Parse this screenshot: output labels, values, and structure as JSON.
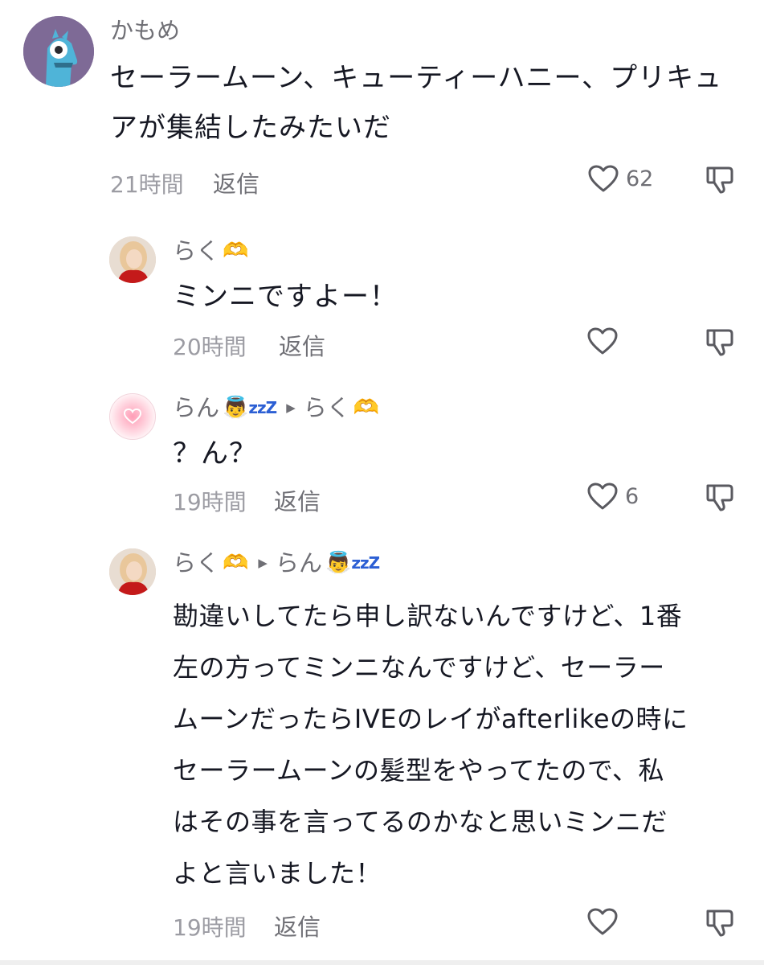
{
  "comments": [
    {
      "username": "かもめ",
      "text_lines": [
        "セーラームーン、キューティーハニー、プリキュ",
        "アが集結したみたいだ"
      ],
      "time": "21時間",
      "reply_label": "返信",
      "like_count": "62",
      "avatar_icon": "monster-avatar"
    },
    {
      "username": "らく",
      "username_emoji": "🫶",
      "text_lines": [
        "ミンニですよー！"
      ],
      "time": "20時間",
      "reply_label": "返信",
      "like_count": "",
      "avatar_icon": "photo-avatar"
    },
    {
      "username": "らん",
      "username_emoji": "👼",
      "username_zzz": "zzZ",
      "reply_to": "らく",
      "reply_to_emoji": "🫶",
      "text_lines": [
        "？ん？"
      ],
      "time": "19時間",
      "reply_label": "返信",
      "like_count": "6",
      "avatar_icon": "pink-heart-avatar"
    },
    {
      "username": "らく",
      "username_emoji": "🫶",
      "reply_to": "らん",
      "reply_to_emoji": "👼",
      "reply_to_zzz": "zzZ",
      "text_lines": [
        "勘違いしてたら申し訳ないんですけど、1番",
        "左の方ってミンニなんですけど、セーラー",
        "ムーンだったらIVEのレイがafterlikeの時に",
        "セーラームーンの髪型をやってたので、私",
        "はその事を言ってるのかなと思いミンニだ",
        "よと言いました！"
      ],
      "time": "19時間",
      "reply_label": "返信",
      "like_count": "",
      "avatar_icon": "photo-avatar"
    }
  ],
  "colors": {
    "text": "#161823",
    "secondary": "#6f6f75",
    "time": "#9c9ca3",
    "icon": "#5a5a60"
  },
  "icons": {
    "like": "heart-outline-icon",
    "dislike": "thumbs-down-outline-icon",
    "reply_to_arrow": "triangle-right-icon"
  }
}
